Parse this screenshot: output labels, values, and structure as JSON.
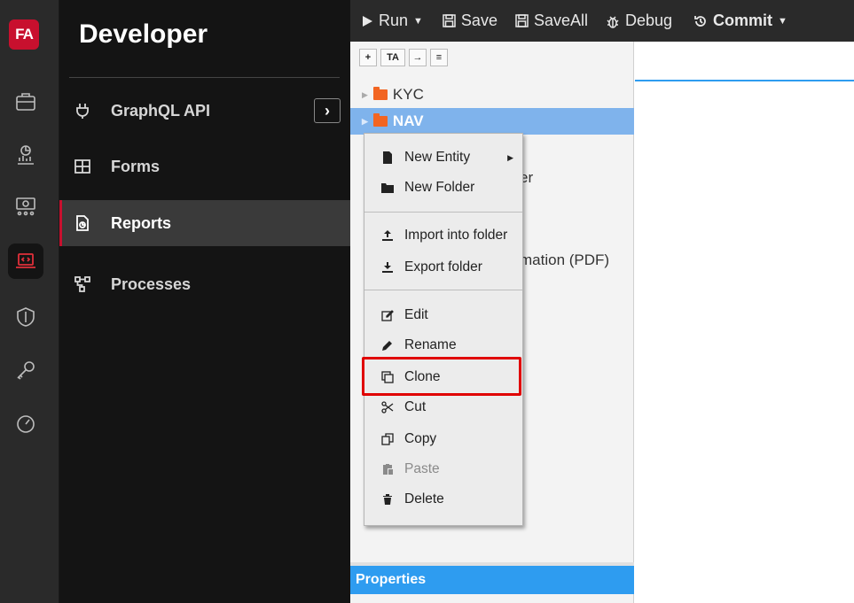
{
  "rail": {
    "logo": "FA",
    "icons": [
      "briefcase-icon",
      "pie-chart-report-icon",
      "money-icon",
      "laptop-code-icon",
      "shield-icon",
      "key-icon",
      "gauge-icon"
    ]
  },
  "sidebar": {
    "title": "Developer",
    "items": [
      {
        "label": "GraphQL API",
        "icon": "plug-icon"
      },
      {
        "label": "Forms",
        "icon": "table-icon"
      },
      {
        "label": "Reports",
        "icon": "report-file-icon"
      },
      {
        "label": "Processes",
        "icon": "process-flow-icon"
      }
    ],
    "expand_symbol": "›"
  },
  "toolbar": {
    "run": "Run",
    "save": "Save",
    "saveall": "SaveAll",
    "debug": "Debug",
    "commit": "Commit"
  },
  "tree": {
    "tools": [
      "+",
      "TA",
      "→",
      "≡"
    ],
    "rows": [
      {
        "label": "KYC",
        "selected": false
      },
      {
        "label": "NAV",
        "selected": true
      }
    ],
    "partial_texts": [
      "er",
      "mation (PDF)"
    ],
    "properties_header": "Properties"
  },
  "context_menu": {
    "items": [
      {
        "label": "New Entity",
        "icon": "new-file-icon",
        "submenu": true
      },
      {
        "label": "New Folder",
        "icon": "folder-icon"
      },
      {
        "label": "Import into folder",
        "icon": "upload-icon"
      },
      {
        "label": "Export folder",
        "icon": "download-icon"
      },
      {
        "label": "Edit",
        "icon": "edit-icon"
      },
      {
        "label": "Rename",
        "icon": "pencil-icon"
      },
      {
        "label": "Clone",
        "icon": "clone-icon",
        "highlighted": true
      },
      {
        "label": "Cut",
        "icon": "scissors-icon"
      },
      {
        "label": "Copy",
        "icon": "copy-icon"
      },
      {
        "label": "Paste",
        "icon": "paste-icon",
        "disabled": true
      },
      {
        "label": "Delete",
        "icon": "trash-icon"
      }
    ]
  },
  "colors": {
    "brand_red": "#c8102e",
    "selected_row": "#7fb3ec",
    "accent_blue": "#2e9cf0",
    "highlight_box": "#e00000"
  }
}
